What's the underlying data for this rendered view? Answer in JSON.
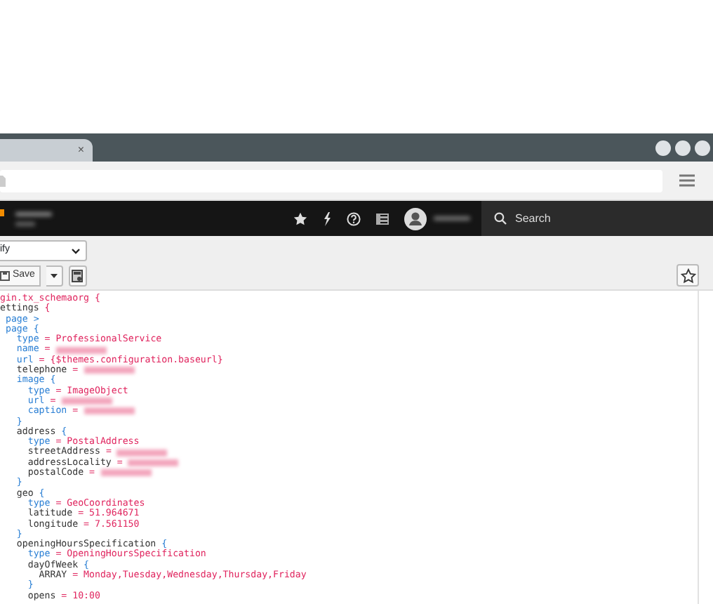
{
  "browser": {
    "tab": {
      "close": "×"
    }
  },
  "app_header": {
    "search": {
      "placeholder": "Search"
    }
  },
  "toolbar": {
    "select": {
      "value": "ify"
    },
    "save_button": "Save"
  },
  "code_lines": [
    {
      "segments": [
        {
          "kind": "value",
          "text": "gin.tx_schemaorg {"
        }
      ]
    },
    {
      "segments": [
        {
          "kind": "key",
          "text": "ettings "
        },
        {
          "kind": "value",
          "text": "{"
        }
      ]
    },
    {
      "segments": [
        {
          "kind": "keyword",
          "text": " page >"
        }
      ]
    },
    {
      "segments": [
        {
          "kind": "keyword",
          "text": " page {"
        }
      ]
    },
    {
      "segments": [
        {
          "kind": "keyword",
          "text": "   type"
        },
        {
          "kind": "value",
          "text": " = ProfessionalService"
        }
      ]
    },
    {
      "segments": [
        {
          "kind": "keyword",
          "text": "   name"
        },
        {
          "kind": "value",
          "text": " ="
        },
        {
          "kind": "redacted"
        }
      ]
    },
    {
      "segments": [
        {
          "kind": "keyword",
          "text": "   url"
        },
        {
          "kind": "value",
          "text": " = {$themes.configuration.baseurl}"
        }
      ]
    },
    {
      "segments": [
        {
          "kind": "key",
          "text": "   telephone"
        },
        {
          "kind": "value",
          "text": " ="
        },
        {
          "kind": "redacted"
        }
      ]
    },
    {
      "segments": [
        {
          "kind": "keyword",
          "text": "   image {"
        }
      ]
    },
    {
      "segments": [
        {
          "kind": "keyword",
          "text": "     type"
        },
        {
          "kind": "value",
          "text": " = ImageObject"
        }
      ]
    },
    {
      "segments": [
        {
          "kind": "keyword",
          "text": "     url"
        },
        {
          "kind": "value",
          "text": " ="
        },
        {
          "kind": "redacted"
        }
      ]
    },
    {
      "segments": [
        {
          "kind": "keyword",
          "text": "     caption"
        },
        {
          "kind": "value",
          "text": " ="
        },
        {
          "kind": "redacted"
        }
      ]
    },
    {
      "segments": [
        {
          "kind": "keyword",
          "text": "   }"
        }
      ]
    },
    {
      "segments": [
        {
          "kind": "key",
          "text": "   address "
        },
        {
          "kind": "keyword",
          "text": "{"
        }
      ]
    },
    {
      "segments": [
        {
          "kind": "keyword",
          "text": "     type"
        },
        {
          "kind": "value",
          "text": " = PostalAddress"
        }
      ]
    },
    {
      "segments": [
        {
          "kind": "key",
          "text": "     streetAddress"
        },
        {
          "kind": "value",
          "text": " ="
        },
        {
          "kind": "redacted"
        }
      ]
    },
    {
      "segments": [
        {
          "kind": "key",
          "text": "     addressLocality"
        },
        {
          "kind": "value",
          "text": " ="
        },
        {
          "kind": "redacted"
        }
      ]
    },
    {
      "segments": [
        {
          "kind": "key",
          "text": "     postalCode"
        },
        {
          "kind": "value",
          "text": " ="
        },
        {
          "kind": "redacted"
        }
      ]
    },
    {
      "segments": [
        {
          "kind": "keyword",
          "text": "   }"
        }
      ]
    },
    {
      "segments": [
        {
          "kind": "key",
          "text": "   geo "
        },
        {
          "kind": "keyword",
          "text": "{"
        }
      ]
    },
    {
      "segments": [
        {
          "kind": "keyword",
          "text": "     type"
        },
        {
          "kind": "value",
          "text": " = GeoCoordinates"
        }
      ]
    },
    {
      "segments": [
        {
          "kind": "key",
          "text": "     latitude"
        },
        {
          "kind": "value",
          "text": " = 51.964671"
        }
      ]
    },
    {
      "segments": [
        {
          "kind": "key",
          "text": "     longitude"
        },
        {
          "kind": "value",
          "text": " = 7.561150"
        }
      ]
    },
    {
      "segments": [
        {
          "kind": "keyword",
          "text": "   }"
        }
      ]
    },
    {
      "segments": [
        {
          "kind": "key",
          "text": "   openingHoursSpecification "
        },
        {
          "kind": "keyword",
          "text": "{"
        }
      ]
    },
    {
      "segments": [
        {
          "kind": "keyword",
          "text": "     type"
        },
        {
          "kind": "value",
          "text": " = OpeningHoursSpecification"
        }
      ]
    },
    {
      "segments": [
        {
          "kind": "key",
          "text": "     dayOfWeek "
        },
        {
          "kind": "keyword",
          "text": "{"
        }
      ]
    },
    {
      "segments": [
        {
          "kind": "key",
          "text": "       ARRAY"
        },
        {
          "kind": "value",
          "text": " = Monday,Tuesday,Wednesday,Thursday,Friday"
        }
      ]
    },
    {
      "segments": [
        {
          "kind": "keyword",
          "text": "     }"
        }
      ]
    },
    {
      "segments": [
        {
          "kind": "key",
          "text": "     opens"
        },
        {
          "kind": "value",
          "text": " = 10:00"
        }
      ]
    }
  ]
}
